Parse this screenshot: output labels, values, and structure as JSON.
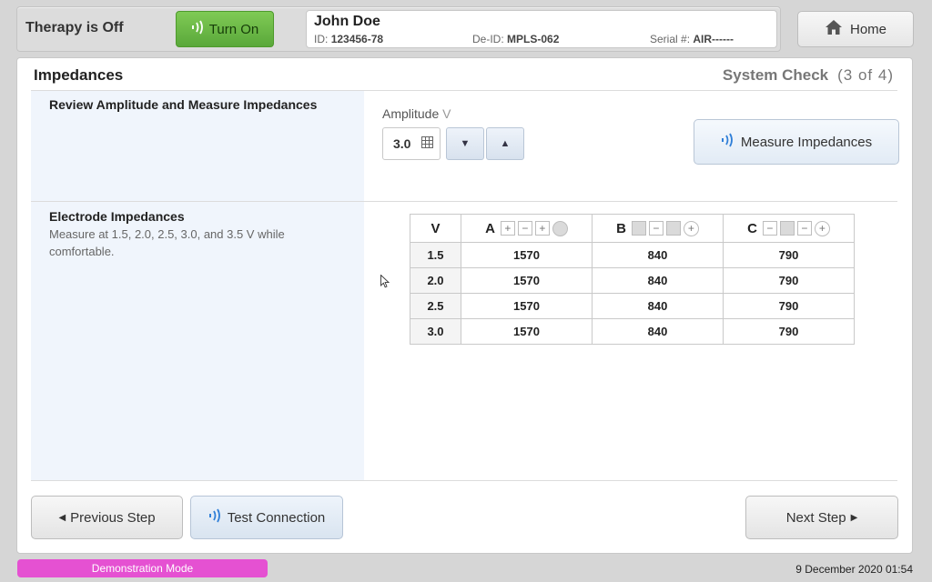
{
  "header": {
    "therapy_status": "Therapy is Off",
    "turn_on_label": "Turn On",
    "patient": {
      "name": "John Doe",
      "id_label": "ID:",
      "id_value": "123456-78",
      "deid_label": "De-ID:",
      "deid_value": "MPLS-062",
      "serial_label": "Serial #:",
      "serial_value": "AIR------"
    },
    "home_label": "Home"
  },
  "page": {
    "title": "Impedances",
    "step_name": "System Check",
    "step_count": "(3 of 4)"
  },
  "amplitude_section": {
    "title": "Review Amplitude and Measure Impedances",
    "label": "Amplitude",
    "unit": "V",
    "value": "3.0",
    "measure_label": "Measure Impedances"
  },
  "electrode_section": {
    "title": "Electrode Impedances",
    "description": "Measure at 1.5, 2.0, 2.5, 3.0, and 3.5 V while comfortable."
  },
  "table": {
    "headers": {
      "v": "V",
      "a": "A",
      "b": "B",
      "c": "C"
    },
    "rows": [
      {
        "v": "1.5",
        "a": "1570",
        "b": "840",
        "c": "790"
      },
      {
        "v": "2.0",
        "a": "1570",
        "b": "840",
        "c": "790"
      },
      {
        "v": "2.5",
        "a": "1570",
        "b": "840",
        "c": "790"
      },
      {
        "v": "3.0",
        "a": "1570",
        "b": "840",
        "c": "790"
      }
    ]
  },
  "footer_buttons": {
    "previous": "Previous Step",
    "test_connection": "Test Connection",
    "next": "Next Step"
  },
  "status": {
    "mode": "Demonstration Mode",
    "datetime": "9 December 2020 01:54"
  },
  "colors": {
    "turn_on_green": "#5aa83a",
    "demo_mode_pink": "#e551d2",
    "wave_icon_blue": "#2f7fd8"
  }
}
